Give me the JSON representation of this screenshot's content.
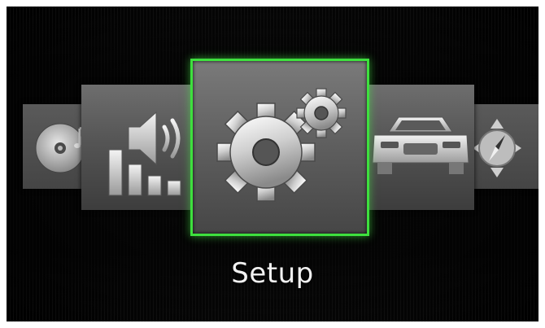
{
  "menu": {
    "items": [
      {
        "id": "music",
        "icon": "music-disc-icon"
      },
      {
        "id": "audio",
        "icon": "speaker-volume-icon"
      },
      {
        "id": "setup",
        "icon": "gears-icon",
        "selected": true
      },
      {
        "id": "vehicle",
        "icon": "car-icon"
      },
      {
        "id": "navigation",
        "icon": "compass-icon"
      }
    ],
    "selected_label": "Setup"
  },
  "colors": {
    "selection_border": "#3ee03e",
    "tile": "#5e5e5e",
    "background": "#0a0a0a",
    "label": "#f2f2f2"
  }
}
